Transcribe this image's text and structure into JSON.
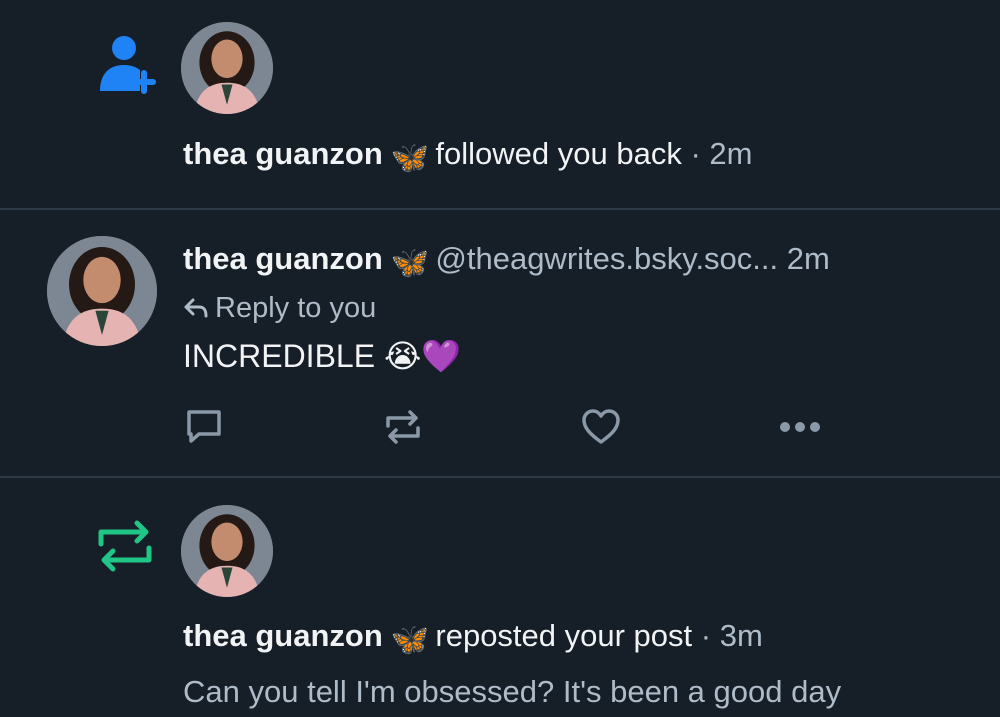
{
  "colors": {
    "background": "#161e27",
    "divider": "#2e3a48",
    "follow_icon": "#1f83f5",
    "repost_icon": "#20c686",
    "muted_text": "#aebbc9",
    "action_icon": "#8a98a8"
  },
  "notifications": [
    {
      "type": "follow",
      "icon": "person-plus-icon",
      "author_name": "thea guanzon",
      "name_emoji": "🦋",
      "action_text": "followed you back",
      "separator": "·",
      "time": "2m"
    },
    {
      "type": "reply",
      "author_name": "thea guanzon",
      "name_emoji": "🦋",
      "handle": "@theagwrites.bsky.soc...",
      "time": "2m",
      "reply_label": "Reply to you",
      "body": "INCREDIBLE 😭💜",
      "actions": [
        "reply-icon",
        "repost-icon",
        "like-icon",
        "more-icon"
      ]
    },
    {
      "type": "repost",
      "icon": "repost-icon",
      "author_name": "thea guanzon",
      "name_emoji": "🦋",
      "action_text": "reposted your post",
      "separator": "·",
      "time": "3m",
      "post_preview": "Can you tell I'm obsessed? It's been a good day"
    }
  ]
}
